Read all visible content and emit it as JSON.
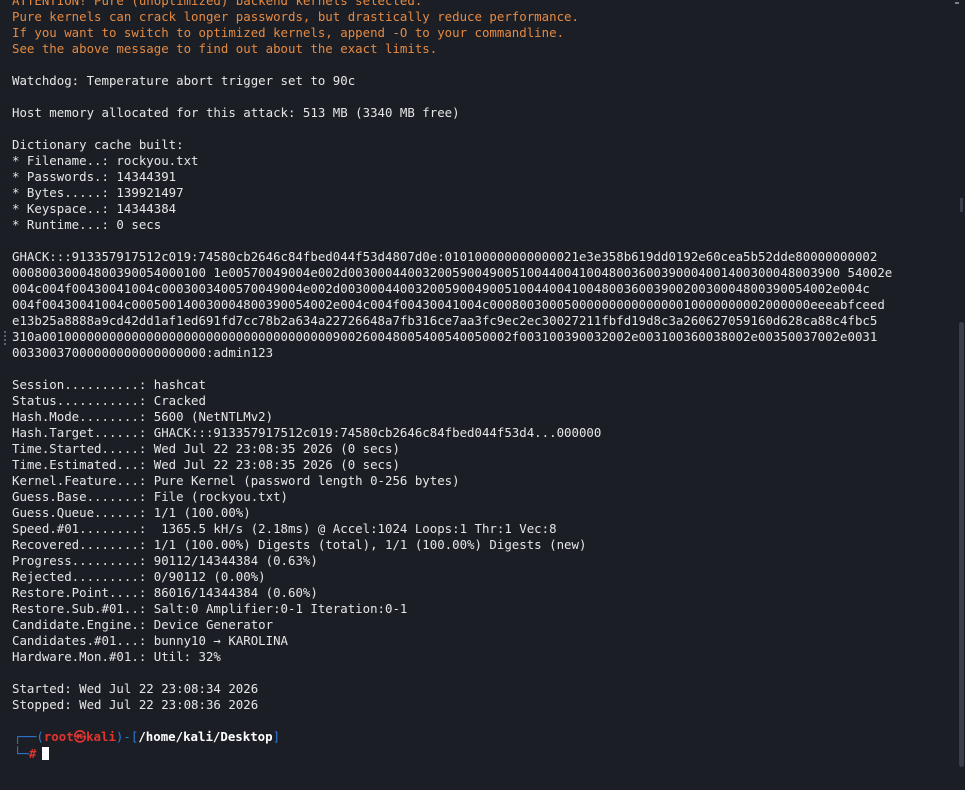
{
  "terminal": {
    "warning_lines": [
      "ATTENTION! Pure (unoptimized) backend kernels selected.",
      "Pure kernels can crack longer passwords, but drastically reduce performance.",
      "If you want to switch to optimized kernels, append -O to your commandline.",
      "See the above message to find out about the exact limits."
    ],
    "watchdog": "Watchdog: Temperature abort trigger set to 90c",
    "host_memory": "Host memory allocated for this attack: 513 MB (3340 MB free)",
    "dictionary": [
      "Dictionary cache built:",
      "* Filename..: rockyou.txt",
      "* Passwords.: 14344391",
      "* Bytes.....: 139921497",
      "* Keyspace..: 14344384",
      "* Runtime...: 0 secs"
    ],
    "hash_lines": [
      "GHACK:::913357917512c019:74580cb2646c84fbed044f53d4807d0e:010100000000000021e3e358b619dd0192e60cea5b52dde80000000002",
      "00080030004800390054000100 1e00570049004e002d003000440032005900490051004400410048003600390004001400300048003900 54002e",
      "004c004f00430041004c0003003400570049004e002d003000440032005900490051004400410048003600390020030004800390054002e004c",
      "004f00430041004c000500140030004800390054002e004c004f00430041004c0008003000500000000000000010000000002000000eeeabfceed",
      "e13b25a8888a9cd42dd1af1ed691fd7cc78b2a634a22726648a7fb316ce7aa3fc9ec2ec30027211fbfd19d8c3a260627059160d628ca88c4fbc5",
      "310a001000000000000000000000000000000000000900260048005400540050002f003100390032002e003100360038002e00350037002e0031",
      "00330037000000000000000000:admin123"
    ],
    "status": [
      "Session..........: hashcat",
      "Status...........: Cracked",
      "Hash.Mode........: 5600 (NetNTLMv2)",
      "Hash.Target......: GHACK:::913357917512c019:74580cb2646c84fbed044f53d4...000000",
      "Time.Started.....: Wed Jul 22 23:08:35 2026 (0 secs)",
      "Time.Estimated...: Wed Jul 22 23:08:35 2026 (0 secs)",
      "Kernel.Feature...: Pure Kernel (password length 0-256 bytes)",
      "Guess.Base.......: File (rockyou.txt)",
      "Guess.Queue......: 1/1 (100.00%)",
      "Speed.#01........:  1365.5 kH/s (2.18ms) @ Accel:1024 Loops:1 Thr:1 Vec:8",
      "Recovered........: 1/1 (100.00%) Digests (total), 1/1 (100.00%) Digests (new)",
      "Progress.........: 90112/14344384 (0.63%)",
      "Rejected.........: 0/90112 (0.00%)",
      "Restore.Point....: 86016/14344384 (0.60%)",
      "Restore.Sub.#01..: Salt:0 Amplifier:0-1 Iteration:0-1",
      "Candidate.Engine.: Device Generator",
      "Candidates.#01...: bunny10 → KAROLINA",
      "Hardware.Mon.#01.: Util: 32%"
    ],
    "started": "Started: Wed Jul 22 23:08:34 2026",
    "stopped": "Stopped: Wed Jul 22 23:08:36 2026",
    "prompt": {
      "open": "┌──(",
      "user": "root",
      "at": "㉿",
      "host": "kali",
      "mid": ")-[",
      "path": "/home/kali/Desktop",
      "close": "]",
      "corner": "└─",
      "symbol": "#"
    }
  },
  "colors": {
    "background": "#1b1e25",
    "text": "#e6e6e6",
    "warning": "#e58a42",
    "prompt_blue": "#2f7bd8",
    "prompt_red": "#e0342f"
  }
}
